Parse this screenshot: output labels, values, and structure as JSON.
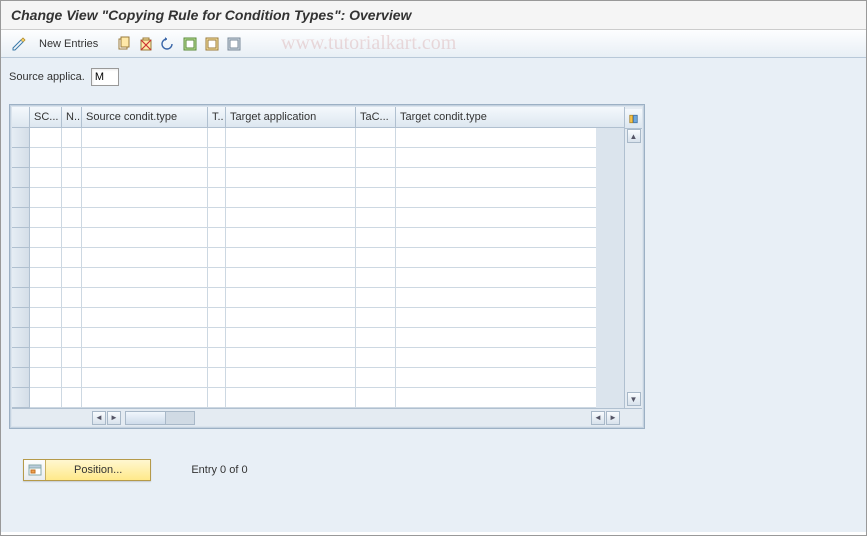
{
  "title": "Change View \"Copying Rule for Condition Types\": Overview",
  "toolbar": {
    "new_entries": "New Entries"
  },
  "watermark": "www.tutorialkart.com",
  "source": {
    "label": "Source applica.",
    "value": "M"
  },
  "table": {
    "columns": {
      "sc": "SC...",
      "n": "N..",
      "sct": "Source condit.type",
      "t": "T..",
      "ta": "Target application",
      "tac": "TaC...",
      "tct": "Target condit.type"
    }
  },
  "footer": {
    "position": "Position...",
    "entry": "Entry 0 of 0"
  }
}
